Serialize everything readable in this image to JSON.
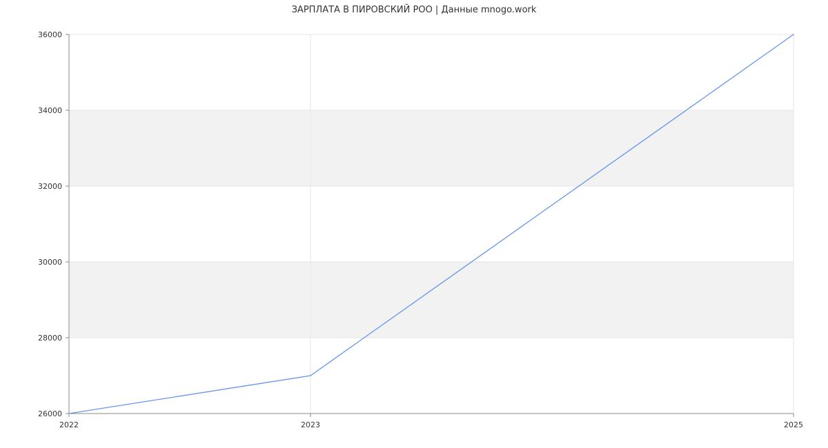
{
  "chart_data": {
    "type": "line",
    "title": "ЗАРПЛАТА В ПИРОВСКИЙ РОО | Данные mnogo.work",
    "xlabel": "",
    "ylabel": "",
    "x": [
      "2022",
      "2023",
      "2025"
    ],
    "series": [
      {
        "values": [
          26000,
          27000,
          36000
        ],
        "color": "#6495ED"
      }
    ],
    "ylim": [
      26000,
      36000
    ],
    "yticks": [
      26000,
      28000,
      30000,
      32000,
      34000,
      36000
    ],
    "xticks": [
      "2022",
      "2023",
      "2025"
    ],
    "grid": true,
    "band_color": "#f2f2f2",
    "grid_color": "#e6e6e6",
    "axis_color": "#888888",
    "legend": "none"
  }
}
